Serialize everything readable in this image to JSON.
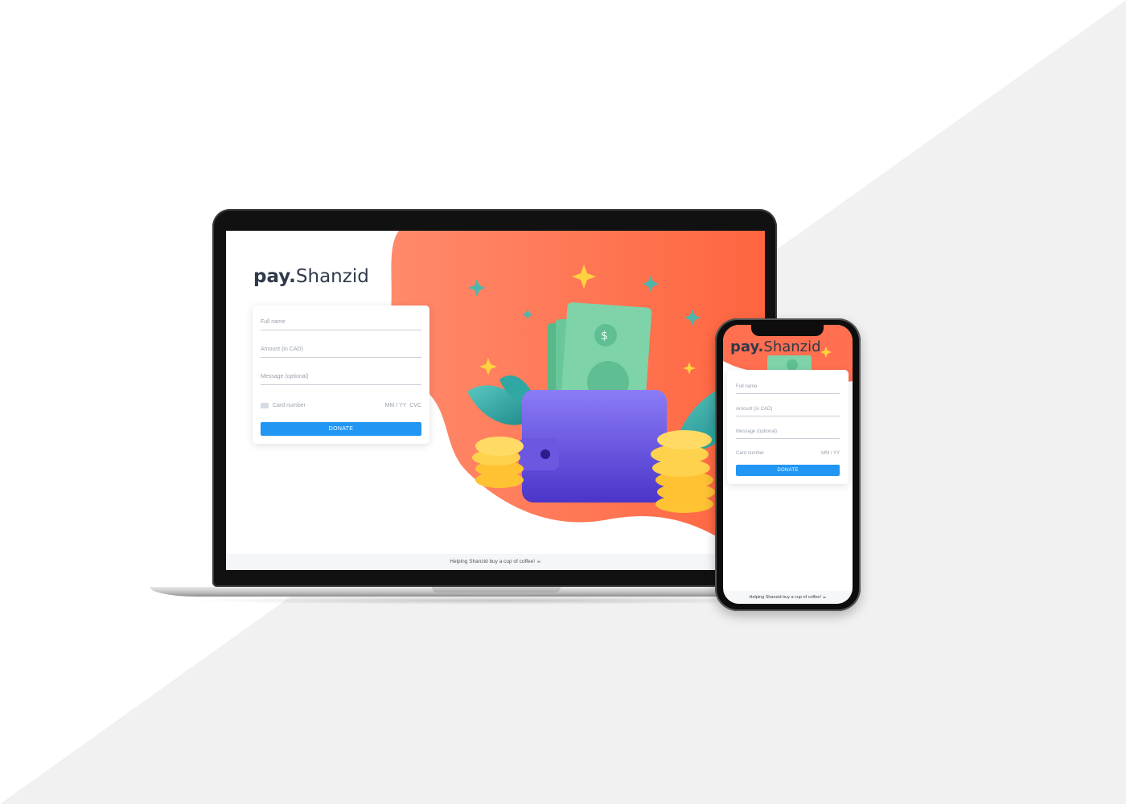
{
  "brand": {
    "prefix": "pay.",
    "name": "Shanzid"
  },
  "form": {
    "full_name_placeholder": "Full name",
    "amount_placeholder": "Amount (in CAD)",
    "message_placeholder": "Message (optional)",
    "card_number_placeholder": "Card number",
    "expiry_placeholder": "MM / YY",
    "cvc_placeholder": "CVC",
    "donate_label": "DONATE"
  },
  "footer": {
    "text": "Helping Shanzid buy a cup of coffee! ☕"
  },
  "colors": {
    "accent": "#2196f3",
    "hero": "#ff6b4f",
    "text": "#2f3a4a",
    "background_gray": "#f1f1f1"
  }
}
